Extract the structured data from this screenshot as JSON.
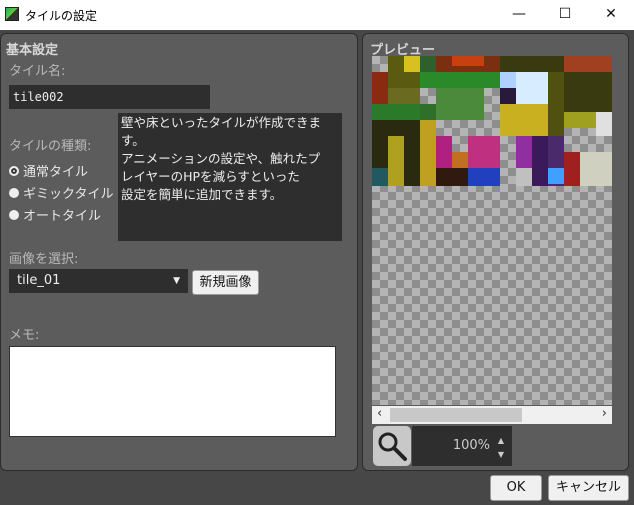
{
  "window": {
    "title": "タイルの設定",
    "minimize": "—",
    "maximize": "☐",
    "close": "✕"
  },
  "basic": {
    "header": "基本設定",
    "name_label": "タイル名:",
    "name_value": "tile002",
    "type_label": "タイルの種類:",
    "types": [
      {
        "label": "通常タイル",
        "selected": true
      },
      {
        "label": "ギミックタイル",
        "selected": false
      },
      {
        "label": "オートタイル",
        "selected": false
      }
    ],
    "description": "壁や床といったタイルが作成できま\nす。\nアニメーションの設定や、触れたプ\nレイヤーのHPを減らすといった\n設定を簡単に追加できます。",
    "image_label": "画像を選択:",
    "image_value": "tile_01",
    "new_image_button": "新規画像",
    "memo_label": "メモ:",
    "memo_value": ""
  },
  "preview": {
    "header": "プレビュー",
    "zoom_value": "100%",
    "scroll_left": "‹",
    "scroll_right": "›"
  },
  "footer": {
    "ok": "OK",
    "cancel": "キャンセル"
  }
}
